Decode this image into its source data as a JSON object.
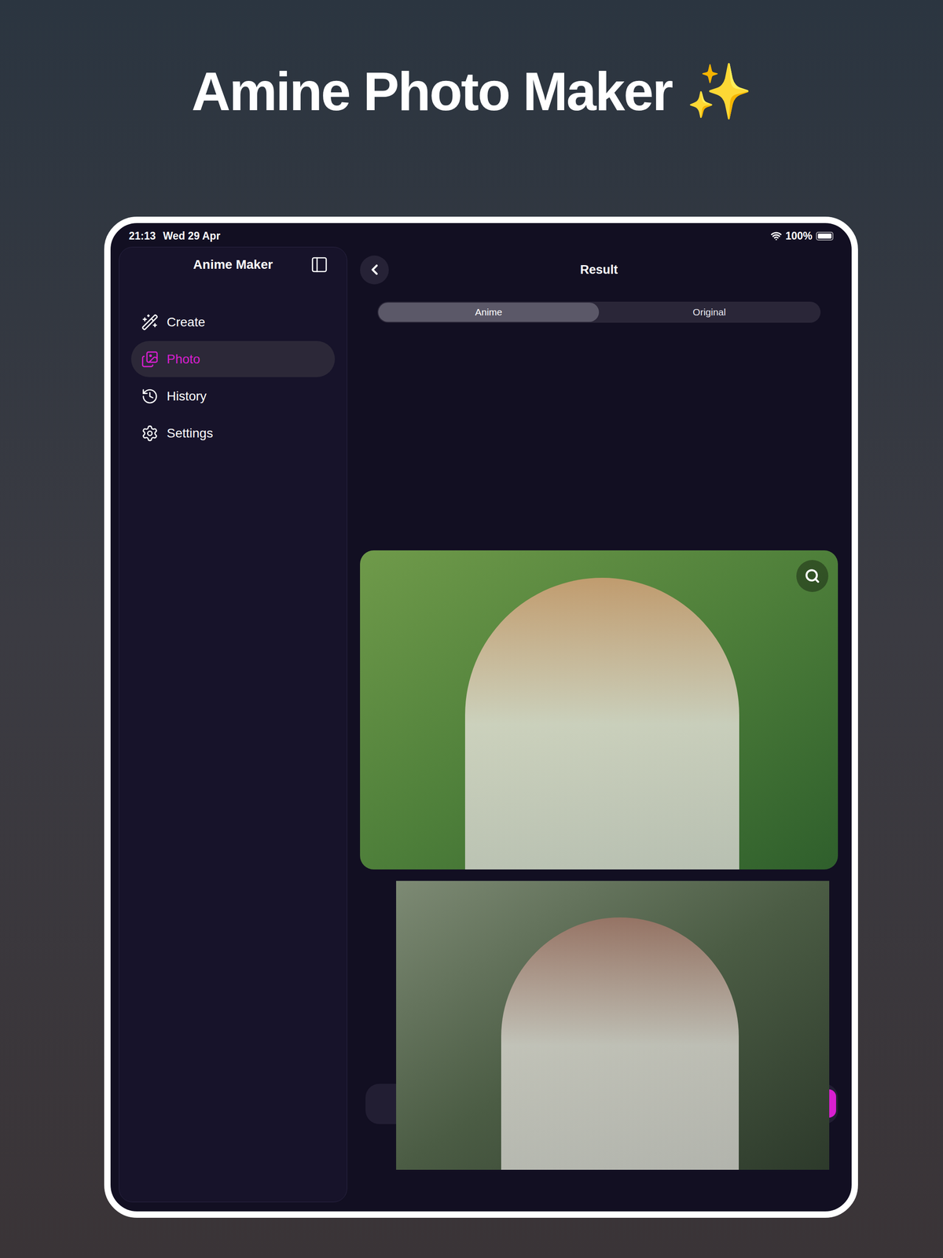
{
  "hero": {
    "title": "Amine Photo Maker ✨"
  },
  "status_bar": {
    "time": "21:13",
    "date": "Wed 29 Apr",
    "battery": "100%",
    "battery_level": 1
  },
  "sidebar": {
    "title": "Anime Maker",
    "items": [
      {
        "label": "Create",
        "selected": false
      },
      {
        "label": "Photo",
        "selected": true
      },
      {
        "label": "History",
        "selected": false
      },
      {
        "label": "Settings",
        "selected": false
      }
    ]
  },
  "main": {
    "title": "Result",
    "tabs": [
      {
        "label": "Anime",
        "selected": true
      },
      {
        "label": "Original",
        "selected": false
      }
    ]
  }
}
